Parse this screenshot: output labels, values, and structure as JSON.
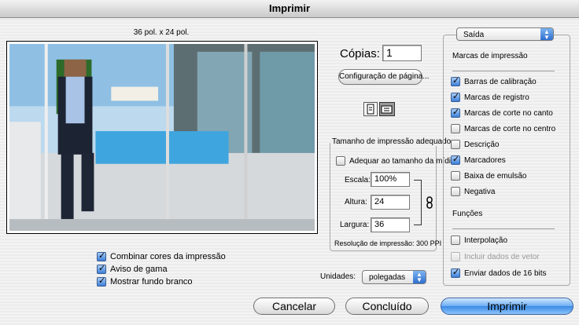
{
  "window": {
    "title": "Imprimir"
  },
  "preview": {
    "size_label": "36 pol. x 24 pol."
  },
  "copies": {
    "label": "Cópias:",
    "value": "1"
  },
  "page_setup_button": "Configuração de página...",
  "orientation": {
    "portrait": "portrait-icon",
    "landscape": "landscape-icon"
  },
  "print_size": {
    "title": "Tamanho de impressão adequado",
    "fit_media": {
      "label": "Adequar ao tamanho da mídia",
      "checked": false
    },
    "scale": {
      "label": "Escala:",
      "value": "100%"
    },
    "height": {
      "label": "Altura:",
      "value": "24"
    },
    "width": {
      "label": "Largura:",
      "value": "36"
    },
    "link_icon": "chain-link-icon",
    "resolution": "Resolução de impressão: 300 PPI"
  },
  "units": {
    "label": "Unidades:",
    "value": "polegadas"
  },
  "left_options": [
    {
      "label": "Combinar cores da impressão",
      "checked": true
    },
    {
      "label": "Aviso de gama",
      "checked": true
    },
    {
      "label": "Mostrar fundo branco",
      "checked": true
    }
  ],
  "output_panel": {
    "popup_value": "Saída",
    "marks_title": "Marcas de impressão",
    "marks": [
      {
        "label": "Barras de calibração",
        "checked": true,
        "disabled": false
      },
      {
        "label": "Marcas de registro",
        "checked": true,
        "disabled": false
      },
      {
        "label": "Marcas de corte no canto",
        "checked": true,
        "disabled": false
      },
      {
        "label": "Marcas de corte no centro",
        "checked": false,
        "disabled": false
      },
      {
        "label": "Descrição",
        "checked": false,
        "disabled": false
      },
      {
        "label": "Marcadores",
        "checked": true,
        "disabled": false
      },
      {
        "label": "Baixa de emulsão",
        "checked": false,
        "disabled": false
      },
      {
        "label": "Negativa",
        "checked": false,
        "disabled": false
      }
    ],
    "functions_title": "Funções",
    "functions": [
      {
        "label": "Interpolação",
        "checked": false,
        "disabled": false
      },
      {
        "label": "Incluir dados de vetor",
        "checked": false,
        "disabled": true
      },
      {
        "label": "Enviar dados de 16 bits",
        "checked": true,
        "disabled": false
      }
    ]
  },
  "buttons": {
    "cancel": "Cancelar",
    "done": "Concluído",
    "print": "Imprimir"
  },
  "colors": {
    "accent": "#3b8ae6",
    "checkbox_on": "#3d7ed8"
  }
}
